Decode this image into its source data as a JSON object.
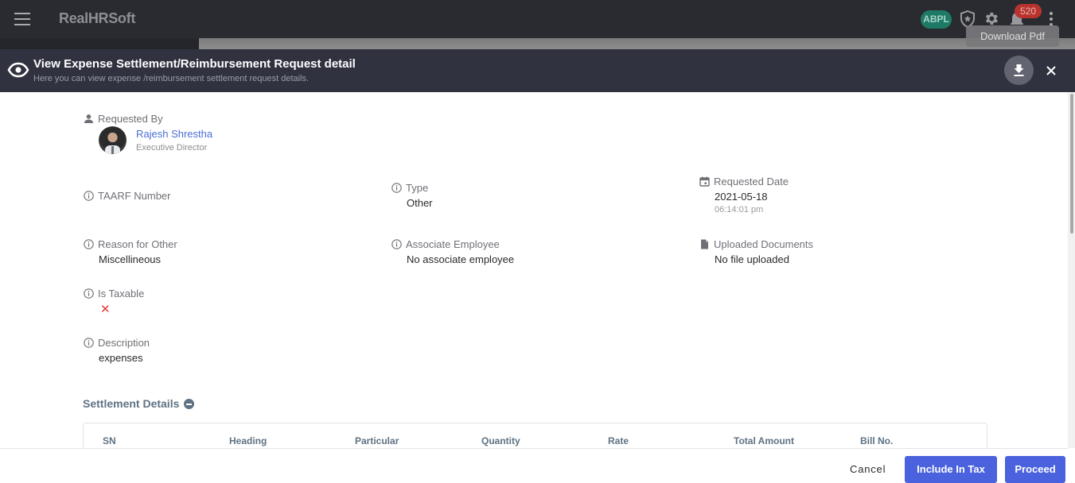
{
  "topbar": {
    "brand": "RealHRSoft",
    "org_badge": "ABPL",
    "notification_count": "520",
    "tooltip": "Download Pdf"
  },
  "modal": {
    "title": "View Expense Settlement/Reimbursement Request detail",
    "subtitle": "Here you can view expense /reimbursement settlement request details."
  },
  "details": {
    "requested_by": {
      "label": "Requested By",
      "name": "Rajesh Shrestha",
      "role": "Executive Director"
    },
    "taarf_number": {
      "label": "TAARF Number",
      "value": ""
    },
    "type": {
      "label": "Type",
      "value": "Other"
    },
    "requested_date": {
      "label": "Requested Date",
      "date": "2021-05-18",
      "time": "06:14:01 pm"
    },
    "reason_for_other": {
      "label": "Reason for Other",
      "value": "Miscellineous"
    },
    "associate_employee": {
      "label": "Associate Employee",
      "value": "No associate employee"
    },
    "uploaded_documents": {
      "label": "Uploaded Documents",
      "value": "No file uploaded"
    },
    "is_taxable": {
      "label": "Is Taxable",
      "value": false,
      "symbol": "✕"
    },
    "description": {
      "label": "Description",
      "value": "expenses"
    }
  },
  "settlement": {
    "title": "Settlement Details",
    "columns": [
      "SN",
      "Heading",
      "Particular",
      "Quantity",
      "Rate",
      "Total Amount",
      "Bill No."
    ]
  },
  "footer": {
    "cancel": "Cancel",
    "include_in_tax": "Include In Tax",
    "proceed": "Proceed"
  },
  "colors": {
    "primary": "#4a62dd",
    "link": "#4a6fd6",
    "danger": "#e53935",
    "header_bg": "#30323f",
    "topbar_bg": "#2a2b31",
    "badge": "#b8332e",
    "org_badge": "#1e7a66"
  }
}
